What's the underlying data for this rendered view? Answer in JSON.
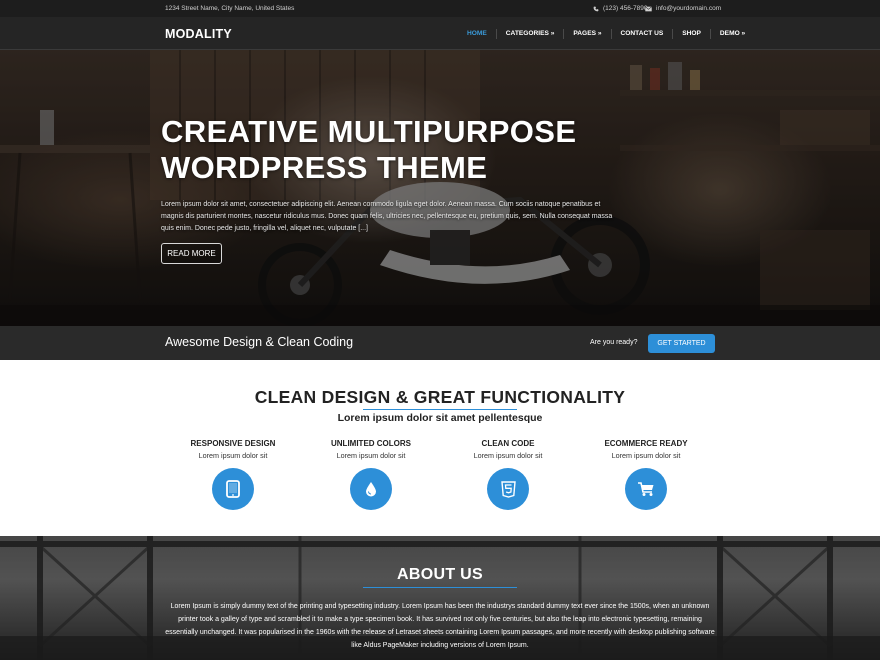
{
  "topbar": {
    "address": "1234 Street Name, City Name, United States",
    "phone": "(123) 456-7890",
    "email": "info@yourdomain.com"
  },
  "header": {
    "logo": "MODALITY",
    "nav": [
      {
        "label": "HOME",
        "active": true
      },
      {
        "label": "CATEGORIES »"
      },
      {
        "label": "PAGES »"
      },
      {
        "label": "CONTACT US"
      },
      {
        "label": "SHOP"
      },
      {
        "label": "DEMO »"
      }
    ]
  },
  "hero": {
    "title_line1": "CREATIVE MULTIPURPOSE",
    "title_line2": "WORDPRESS THEME",
    "text": "Lorem ipsum dolor sit amet, consectetuer adipiscing elit. Aenean commodo ligula eget dolor. Aenean massa. Cum sociis natoque penatibus et magnis dis parturient montes, nascetur ridiculus mus. Donec quam felis, ultricies nec, pellentesque eu, pretium quis, sem. Nulla consequat massa quis enim. Donec pede justo, fringilla vel, aliquet nec, vulputate [...]",
    "button": "READ MORE"
  },
  "cta": {
    "text": "Awesome Design & Clean Coding",
    "prompt": "Are you ready?",
    "button": "GET STARTED"
  },
  "features": {
    "title": "CLEAN DESIGN & GREAT FUNCTIONALITY",
    "subtitle": "Lorem ipsum dolor sit amet pellentesque",
    "items": [
      {
        "title": "RESPONSIVE DESIGN",
        "text": "Lorem ipsum dolor sit",
        "icon": "tablet-icon"
      },
      {
        "title": "UNLIMITED COLORS",
        "text": "Lorem ipsum dolor sit",
        "icon": "droplet-icon"
      },
      {
        "title": "CLEAN CODE",
        "text": "Lorem ipsum dolor sit",
        "icon": "html5-icon"
      },
      {
        "title": "ECOMMERCE READY",
        "text": "Lorem ipsum dolor sit",
        "icon": "cart-icon"
      }
    ]
  },
  "about": {
    "title": "ABOUT US",
    "text": "Lorem Ipsum is simply dummy text of the printing and typesetting industry. Lorem Ipsum has been the industrys standard dummy text ever since the 1500s, when an unknown printer took a galley of type and scrambled it to make a type specimen book. It has survived not only five centuries, but also the leap into electronic typesetting, remaining essentially unchanged. It was popularised in the 1960s with the release of Letraset sheets containing Lorem Ipsum passages, and more recently with desktop publishing software like Aldus PageMaker including versions of Lorem Ipsum."
  },
  "colors": {
    "accent": "#2d8fd8",
    "nav_active": "#3a9ad9",
    "header_bg": "#252525",
    "topbar_bg": "#1d1d1d",
    "cta_bg": "#2a2a2a"
  }
}
